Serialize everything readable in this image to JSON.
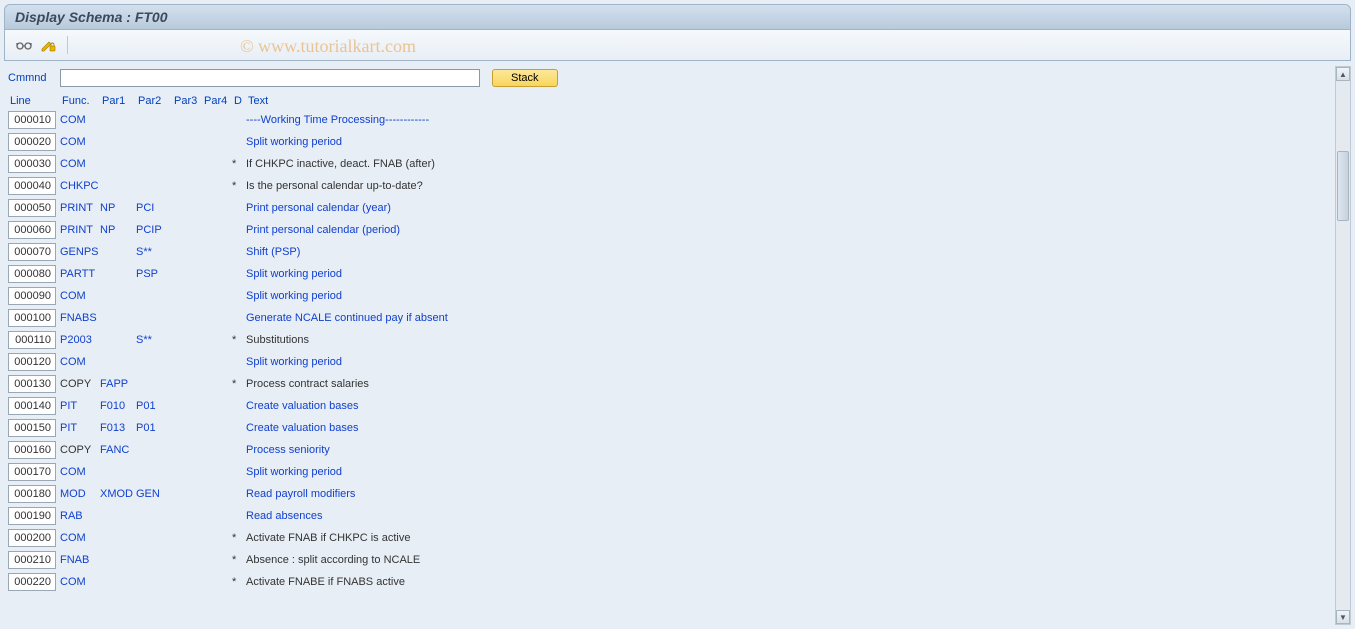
{
  "title": "Display Schema : FT00",
  "watermark": "© www.tutorialkart.com",
  "toolbar": {
    "icon1_name": "glasses-icon",
    "icon2_name": "lock-icon"
  },
  "command": {
    "label": "Cmmnd",
    "value": "",
    "stack_label": "Stack"
  },
  "headers": {
    "line": "Line",
    "func": "Func.",
    "par1": "Par1",
    "par2": "Par2",
    "par3": "Par3",
    "par4": "Par4",
    "d": "D",
    "text": "Text"
  },
  "rows": [
    {
      "line": "000010",
      "func": "COM",
      "par1": "",
      "par2": "",
      "par3": "",
      "par4": "",
      "d": "",
      "text": "----Working Time Processing------------",
      "link": true
    },
    {
      "line": "000020",
      "func": "COM",
      "par1": "",
      "par2": "",
      "par3": "",
      "par4": "",
      "d": "",
      "text": "Split working period",
      "link": true
    },
    {
      "line": "000030",
      "func": "COM",
      "par1": "",
      "par2": "",
      "par3": "",
      "par4": "",
      "d": "*",
      "text": "If CHKPC inactive, deact. FNAB (after)",
      "link": false
    },
    {
      "line": "000040",
      "func": "CHKPC",
      "par1": "",
      "par2": "",
      "par3": "",
      "par4": "",
      "d": "*",
      "text": "Is the personal calendar up-to-date?",
      "link": false
    },
    {
      "line": "000050",
      "func": "PRINT",
      "par1": "NP",
      "par2": "PCI",
      "par3": "",
      "par4": "",
      "d": "",
      "text": "Print personal calendar (year)",
      "link": true
    },
    {
      "line": "000060",
      "func": "PRINT",
      "par1": "NP",
      "par2": "PCIP",
      "par3": "",
      "par4": "",
      "d": "",
      "text": "Print personal calendar (period)",
      "link": true
    },
    {
      "line": "000070",
      "func": "GENPS",
      "par1": "",
      "par2": "S**",
      "par3": "",
      "par4": "",
      "d": "",
      "text": "Shift (PSP)",
      "link": true
    },
    {
      "line": "000080",
      "func": "PARTT",
      "par1": "",
      "par2": "PSP",
      "par3": "",
      "par4": "",
      "d": "",
      "text": "Split working period",
      "link": true
    },
    {
      "line": "000090",
      "func": "COM",
      "par1": "",
      "par2": "",
      "par3": "",
      "par4": "",
      "d": "",
      "text": "Split working period",
      "link": true
    },
    {
      "line": "000100",
      "func": "FNABS",
      "par1": "",
      "par2": "",
      "par3": "",
      "par4": "",
      "d": "",
      "text": "Generate NCALE continued pay if absent",
      "link": true
    },
    {
      "line": "000110",
      "func": "P2003",
      "par1": "",
      "par2": "S**",
      "par3": "",
      "par4": "",
      "d": "*",
      "text": "Substitutions",
      "link": false
    },
    {
      "line": "000120",
      "func": "COM",
      "par1": "",
      "par2": "",
      "par3": "",
      "par4": "",
      "d": "",
      "text": "Split working period",
      "link": true
    },
    {
      "line": "000130",
      "func": "COPY",
      "par1": "FAPP",
      "par2": "",
      "par3": "",
      "par4": "",
      "d": "*",
      "text": "Process contract salaries",
      "link": false,
      "func_link": false
    },
    {
      "line": "000140",
      "func": "PIT",
      "par1": "F010",
      "par2": "P01",
      "par3": "",
      "par4": "",
      "d": "",
      "text": "Create valuation bases",
      "link": true
    },
    {
      "line": "000150",
      "func": "PIT",
      "par1": "F013",
      "par2": "P01",
      "par3": "",
      "par4": "",
      "d": "",
      "text": "Create valuation bases",
      "link": true
    },
    {
      "line": "000160",
      "func": "COPY",
      "par1": "FANC",
      "par2": "",
      "par3": "",
      "par4": "",
      "d": "",
      "text": "Process seniority",
      "link": true,
      "func_link": false
    },
    {
      "line": "000170",
      "func": "COM",
      "par1": "",
      "par2": "",
      "par3": "",
      "par4": "",
      "d": "",
      "text": "Split working period",
      "link": true
    },
    {
      "line": "000180",
      "func": "MOD",
      "par1": "XMOD",
      "par2": "GEN",
      "par3": "",
      "par4": "",
      "d": "",
      "text": "Read payroll modifiers",
      "link": true
    },
    {
      "line": "000190",
      "func": "RAB",
      "par1": "",
      "par2": "",
      "par3": "",
      "par4": "",
      "d": "",
      "text": "Read absences",
      "link": true
    },
    {
      "line": "000200",
      "func": "COM",
      "par1": "",
      "par2": "",
      "par3": "",
      "par4": "",
      "d": "*",
      "text": "Activate FNAB if CHKPC is active",
      "link": false
    },
    {
      "line": "000210",
      "func": "FNAB",
      "par1": "",
      "par2": "",
      "par3": "",
      "par4": "",
      "d": "*",
      "text": "Absence : split according to NCALE",
      "link": false
    },
    {
      "line": "000220",
      "func": "COM",
      "par1": "",
      "par2": "",
      "par3": "",
      "par4": "",
      "d": "*",
      "text": "Activate FNABE if FNABS active",
      "link": false
    }
  ]
}
